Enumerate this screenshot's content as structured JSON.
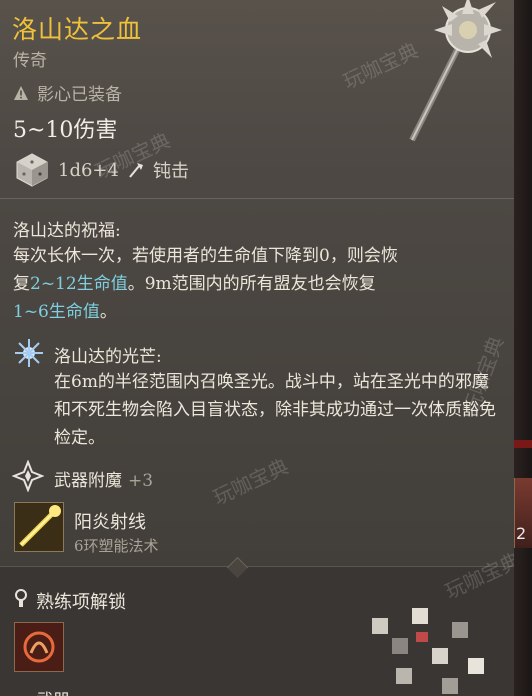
{
  "item": {
    "name": "洛山达之血",
    "rarity": "传奇",
    "warning": "影心已装备",
    "damage": "5~10伤害",
    "dice": "1d6+4",
    "damage_type": "钝击"
  },
  "blessing": {
    "heading": "洛山达的祝福:",
    "line1": "每次长休一次，若使用者的生命值下降到0，则会恢",
    "line2_pre": "复",
    "line2_teal": "2~12生命值",
    "line2_post": "。9m范围内的所有盟友也会恢复",
    "line3_teal": "1~6生命值",
    "line3_post": "。"
  },
  "radiance": {
    "heading": "洛山达的光芒:",
    "text": "在6m的半径范围内召唤圣光。战斗中，站在圣光中的邪魔和不死生物会陷入目盲状态，除非其成功通过一次体质豁免检定。"
  },
  "enchant": {
    "label": "武器附魔",
    "value": "+3"
  },
  "spell": {
    "name": "阳炎射线",
    "subtitle": "6环塑能法术"
  },
  "proficiency": {
    "label": "熟练项解锁"
  },
  "bottom_partial": "武器…",
  "edge_number": "2",
  "watermark": "玩咖宝典",
  "colors": {
    "title": "#f0c23a",
    "teal": "#7fcfe0",
    "panel": "#4e4944"
  },
  "icons": [
    "warning-icon",
    "dice-icon",
    "bludgeon-icon",
    "radiance-icon",
    "enchant-icon",
    "spell-icon",
    "proficiency-icon",
    "mace-icon"
  ]
}
